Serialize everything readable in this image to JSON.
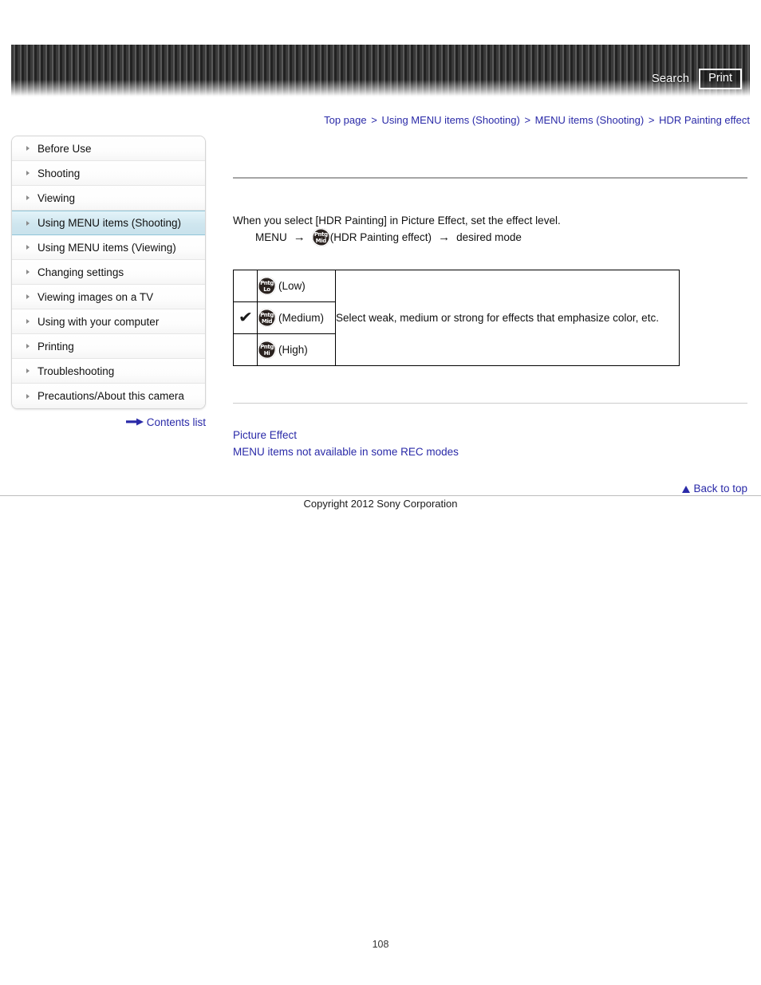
{
  "header": {
    "search_label": "Search",
    "print_label": "Print"
  },
  "breadcrumb": {
    "separator": ">",
    "items": [
      {
        "label": "Top page"
      },
      {
        "label": "Using MENU items (Shooting)"
      },
      {
        "label": "MENU items (Shooting)"
      },
      {
        "label": "HDR Painting effect"
      }
    ]
  },
  "sidebar": {
    "items": [
      {
        "label": "Before Use",
        "active": false
      },
      {
        "label": "Shooting",
        "active": false
      },
      {
        "label": "Viewing",
        "active": false
      },
      {
        "label": "Using MENU items (Shooting)",
        "active": true
      },
      {
        "label": "Using MENU items (Viewing)",
        "active": false
      },
      {
        "label": "Changing settings",
        "active": false
      },
      {
        "label": "Viewing images on a TV",
        "active": false
      },
      {
        "label": "Using with your computer",
        "active": false
      },
      {
        "label": "Printing",
        "active": false
      },
      {
        "label": "Troubleshooting",
        "active": false
      },
      {
        "label": "Precautions/About this camera",
        "active": false
      }
    ],
    "contents_list_label": "Contents list"
  },
  "main": {
    "intro": "When you select [HDR Painting] in Picture Effect, set the effect level.",
    "menu_path": {
      "menu_label": "MENU",
      "arrow": "→",
      "icon_line1": "Pntg",
      "icon_line2": "Mid",
      "icon_caption": "(HDR Painting effect)",
      "arrow2": "→",
      "tail_label": "desired mode"
    },
    "options_table": {
      "check_glyph": "✔",
      "description": "Select weak, medium or strong for effects that emphasize color, etc.",
      "rows": [
        {
          "selected": false,
          "icon_line1": "Pntg",
          "icon_line2": "Lo",
          "label": "(Low)"
        },
        {
          "selected": true,
          "icon_line1": "Pntg",
          "icon_line2": "Mid",
          "label": "(Medium)"
        },
        {
          "selected": false,
          "icon_line1": "Pntg",
          "icon_line2": "Hi",
          "label": "(High)"
        }
      ]
    },
    "related_links": [
      {
        "label": "Picture Effect"
      },
      {
        "label": "MENU items not available in some REC modes"
      }
    ]
  },
  "footer": {
    "back_to_top_label": "Back to top",
    "copyright": "Copyright 2012 Sony Corporation",
    "page_number": "108"
  },
  "colors": {
    "link": "#2a2aa8",
    "active_nav": "#cfe6ef",
    "header_dark": "#222222"
  }
}
